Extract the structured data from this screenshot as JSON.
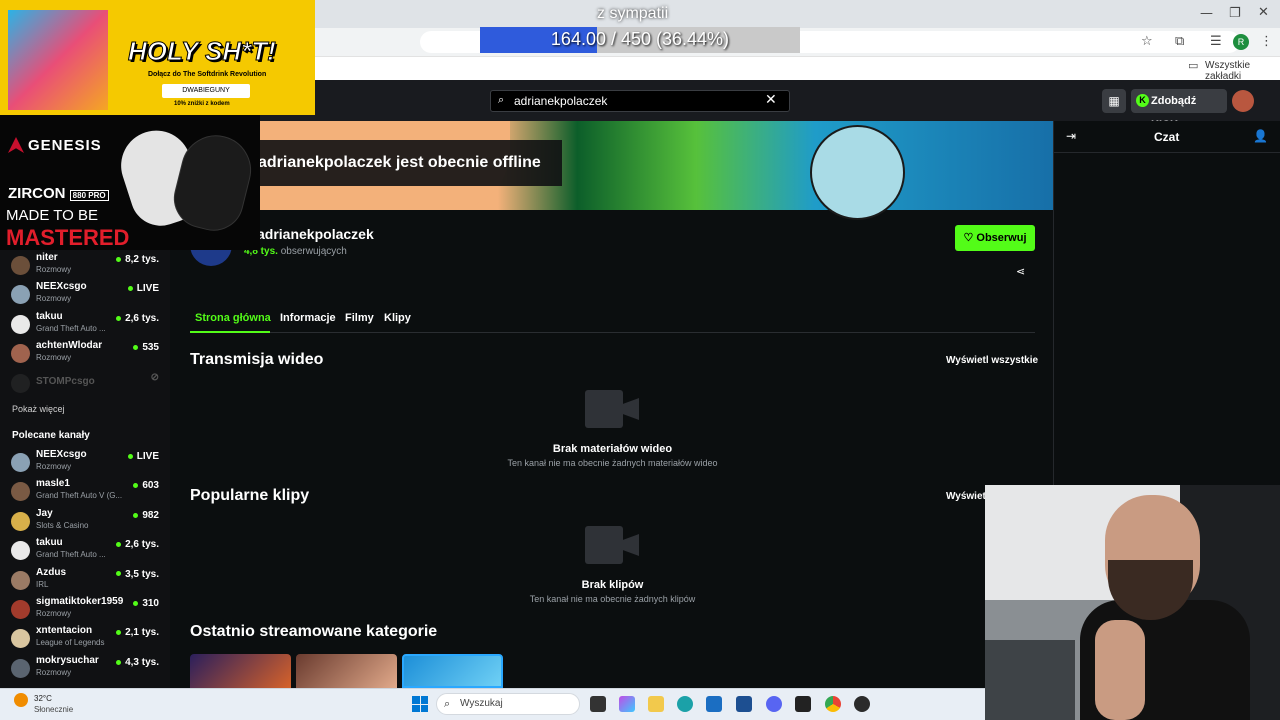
{
  "browser": {
    "all_bookmarks": "Wszystkie zakładki",
    "profile_initial": "R"
  },
  "overlay": {
    "sympatii_label": "z sympatii",
    "sympatii_progress": "164.00 / 450 (36.44%)",
    "sympatii_fraction": 0.3644
  },
  "ads": {
    "holy": {
      "title": "HOLY SH*T!",
      "subtitle": "Dołącz do The Softdrink Revolution",
      "code": "DWABIEGUNY",
      "discount": "10% zniżki z kodem"
    },
    "genesis": {
      "brand": "GENESIS",
      "product": "ZIRCON",
      "model": "880 PRO",
      "tagline1": "MADE TO BE",
      "tagline2": "MASTERED"
    }
  },
  "header": {
    "search_value": "adrianekpolaczek",
    "get_kicks": "Zdobądź KICKs"
  },
  "sidebar": {
    "followed": [
      {
        "name": "niter",
        "sub": "Rozmowy",
        "count": "8,2 tys.",
        "color": "#6b4f3a"
      },
      {
        "name": "NEEXcsgo",
        "sub": "Rozmowy",
        "count": "LIVE",
        "color": "#8aa1b4"
      },
      {
        "name": "takuu",
        "sub": "Grand Theft Auto ...",
        "count": "2,6 tys.",
        "color": "#e9e9e9"
      },
      {
        "name": "achtenWlodar",
        "sub": "Rozmowy",
        "count": "535",
        "color": "#a0634e"
      },
      {
        "name": "STOMPcsgo",
        "sub": "",
        "count": "",
        "color": "#3a3a3a"
      }
    ],
    "show_more": "Pokaż więcej",
    "recommended_title": "Polecane kanały",
    "recommended": [
      {
        "name": "NEEXcsgo",
        "sub": "Rozmowy",
        "count": "LIVE",
        "color": "#8aa1b4"
      },
      {
        "name": "masle1",
        "sub": "Grand Theft Auto V (G...",
        "count": "603",
        "color": "#7a5a44"
      },
      {
        "name": "Jay",
        "sub": "Slots & Casino",
        "count": "982",
        "color": "#d8b04a"
      },
      {
        "name": "takuu",
        "sub": "Grand Theft Auto ...",
        "count": "2,6 tys.",
        "color": "#e9e9e9"
      },
      {
        "name": "Azdus",
        "sub": "IRL",
        "count": "3,5 tys.",
        "color": "#9b7b65"
      },
      {
        "name": "sigmatiktoker1959",
        "sub": "Rozmowy",
        "count": "310",
        "color": "#a23b2c"
      },
      {
        "name": "xntentacion",
        "sub": "League of Legends",
        "count": "2,1 tys.",
        "color": "#d9c6a0"
      },
      {
        "name": "mokrysuchar",
        "sub": "Rozmowy",
        "count": "4,3 tys.",
        "color": "#5a6470"
      }
    ]
  },
  "channel": {
    "offline_msg": "adrianekpolaczek jest obecnie offline",
    "name": "adrianekpolaczek",
    "followers_num": "4,8 tys.",
    "followers_label": "obserwujących",
    "follow": "Obserwuj"
  },
  "tabs": [
    "Strona główna",
    "Informacje",
    "Filmy",
    "Klipy"
  ],
  "sections": {
    "videos_title": "Transmisja wideo",
    "videos_more": "Wyświetl wszystkie",
    "videos_empty_title": "Brak materiałów wideo",
    "videos_empty_sub": "Ten kanał nie ma obecnie żadnych materiałów wideo",
    "clips_title": "Popularne klipy",
    "clips_more": "Wyświetl",
    "clips_empty_title": "Brak klipów",
    "clips_empty_sub": "Ten kanał nie ma obecnie żadnych klipów",
    "categories_title": "Ostatnio streamowane kategorie"
  },
  "chat": {
    "title": "Czat"
  },
  "taskbar": {
    "temp": "32°C",
    "weather": "Słonecznie",
    "search": "Wyszukaj"
  },
  "colors": {
    "accent": "#53fc18",
    "bg": "#0b0e0f"
  }
}
